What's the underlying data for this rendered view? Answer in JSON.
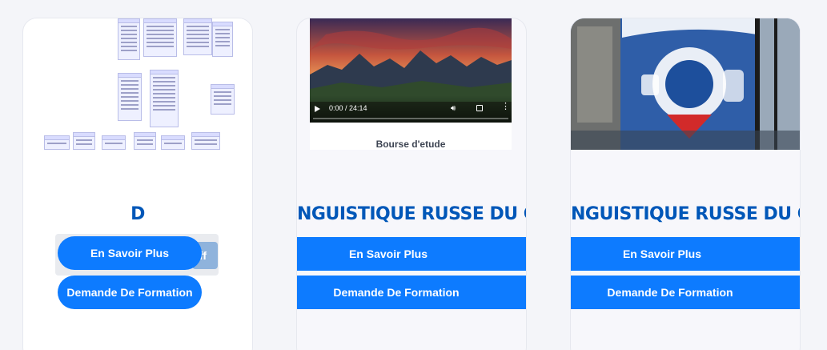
{
  "cards": [
    {
      "title": "D",
      "ghost_text": "fff",
      "more_label": "En Savoir Plus",
      "form_label": "Demande De Formation"
    },
    {
      "title": "NGUISTIQUE RUSSE DU CA",
      "video_time": "0:00 / 24:14",
      "video_caption": "Bourse d'etude",
      "more_label": "En Savoir Plus",
      "form_label": "Demande De Formation"
    },
    {
      "title": "NGUISTIQUE RUSSE DU CA",
      "more_label": "En Savoir Plus",
      "form_label": "Demande De Formation"
    }
  ],
  "colors": {
    "accent": "#0d7bff",
    "title": "#0057b8",
    "card_bg": "#ffffff",
    "page_bg": "#f4f5f9"
  }
}
